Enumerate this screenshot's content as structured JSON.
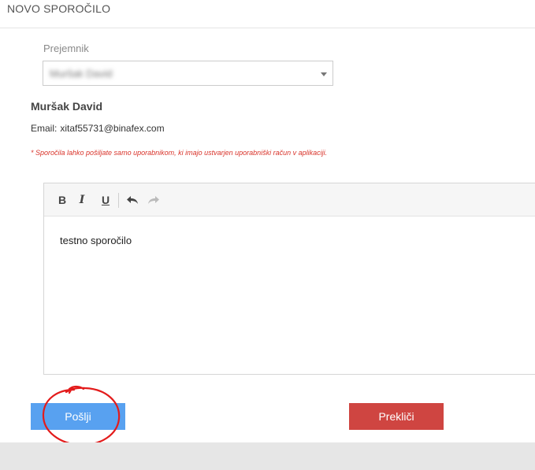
{
  "header": {
    "title": "NOVO SPOROČILO"
  },
  "recipient": {
    "label": "Prejemnik",
    "selected_value": "Muršak David"
  },
  "contact": {
    "name": "Muršak David",
    "email_label": "Email:",
    "email": "xitaf55731@binafex.com"
  },
  "notice": "* Sporočila lahko pošiljate samo uporabnikom, ki imajo ustvarjen uporabniški račun v aplikaciji.",
  "editor": {
    "toolbar": {
      "bold": "B",
      "italic": "I",
      "underline": "U"
    },
    "content": "testno sporočilo"
  },
  "actions": {
    "send_label": "Pošlji",
    "cancel_label": "Prekliči"
  },
  "colors": {
    "send": "#58a1f0",
    "cancel": "#cf4541",
    "notice": "#d9342b",
    "annotation": "#e31b1b"
  }
}
